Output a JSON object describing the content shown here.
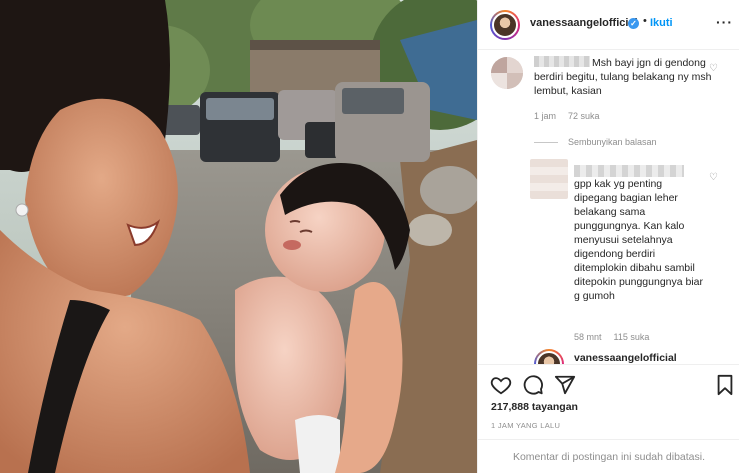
{
  "post": {
    "username": "vanessaangelofficial",
    "verified_icon": "verified-badge-icon",
    "separator": "•",
    "follow_label": "Ikuti",
    "more_icon": "more-options-icon"
  },
  "comments": [
    {
      "username_redacted": true,
      "text": "Msh bayi jgn di gendong berdiri begitu, tulang belakang ny msh lembut, kasian",
      "time": "1 jam",
      "likes": "72 suka"
    }
  ],
  "hide_replies_label": "Sembunyikan balasan",
  "reply": {
    "username_redacted": true,
    "text": "gpp kak yg penting dipegang bagian leher belakang sama punggungnya. Kan kalo menyusui setelahnya digendong berdiri ditemplokin dibahu sambil ditepokin punggungnya biar g gumoh",
    "time": "58 mnt",
    "likes": "115 suka"
  },
  "next_comment": {
    "username": "vanessaangelofficial"
  },
  "actions": {
    "like_icon": "heart-icon",
    "comment_icon": "comment-icon",
    "share_icon": "share-icon",
    "save_icon": "bookmark-icon"
  },
  "views": "217,888 tayangan",
  "time_ago": "1 JAM YANG LALU",
  "comments_disabled": "Komentar di postingan ini sudah dibatasi.",
  "colors": {
    "accent": "#0095f6",
    "verified": "#3897f0",
    "secondary_text": "#8e8e8e",
    "border": "#efefef"
  }
}
